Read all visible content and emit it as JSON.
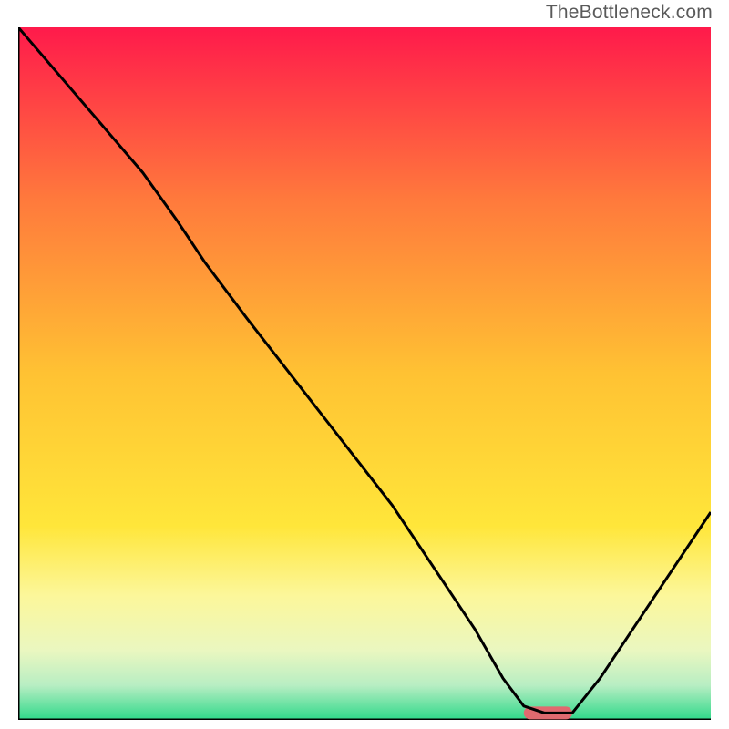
{
  "watermark": "TheBottleneck.com",
  "chart_data": {
    "type": "line",
    "title": "",
    "xlabel": "",
    "ylabel": "",
    "xlim": [
      0,
      100
    ],
    "ylim": [
      0,
      100
    ],
    "grid": false,
    "legend": false,
    "gradient_stops": [
      {
        "offset": 0,
        "color": "#ff1a4b"
      },
      {
        "offset": 25,
        "color": "#ff7a3c"
      },
      {
        "offset": 50,
        "color": "#ffc233"
      },
      {
        "offset": 72,
        "color": "#ffe63a"
      },
      {
        "offset": 82,
        "color": "#fcf79a"
      },
      {
        "offset": 90,
        "color": "#eaf7c0"
      },
      {
        "offset": 95,
        "color": "#b8eec3"
      },
      {
        "offset": 100,
        "color": "#2fd88a"
      }
    ],
    "series": [
      {
        "name": "bottleneck-curve",
        "x": [
          0,
          6,
          12,
          18,
          23,
          27,
          33,
          40,
          47,
          54,
          60,
          66,
          70,
          73,
          76,
          80,
          84,
          88,
          92,
          96,
          100
        ],
        "y": [
          100,
          93,
          86,
          79,
          72,
          66,
          58,
          49,
          40,
          31,
          22,
          13,
          6,
          2,
          1,
          1,
          6,
          12,
          18,
          24,
          30
        ]
      }
    ],
    "marker": {
      "name": "optimal-range",
      "x_start": 73,
      "x_end": 80,
      "y": 1,
      "color": "#e06a6f"
    }
  }
}
